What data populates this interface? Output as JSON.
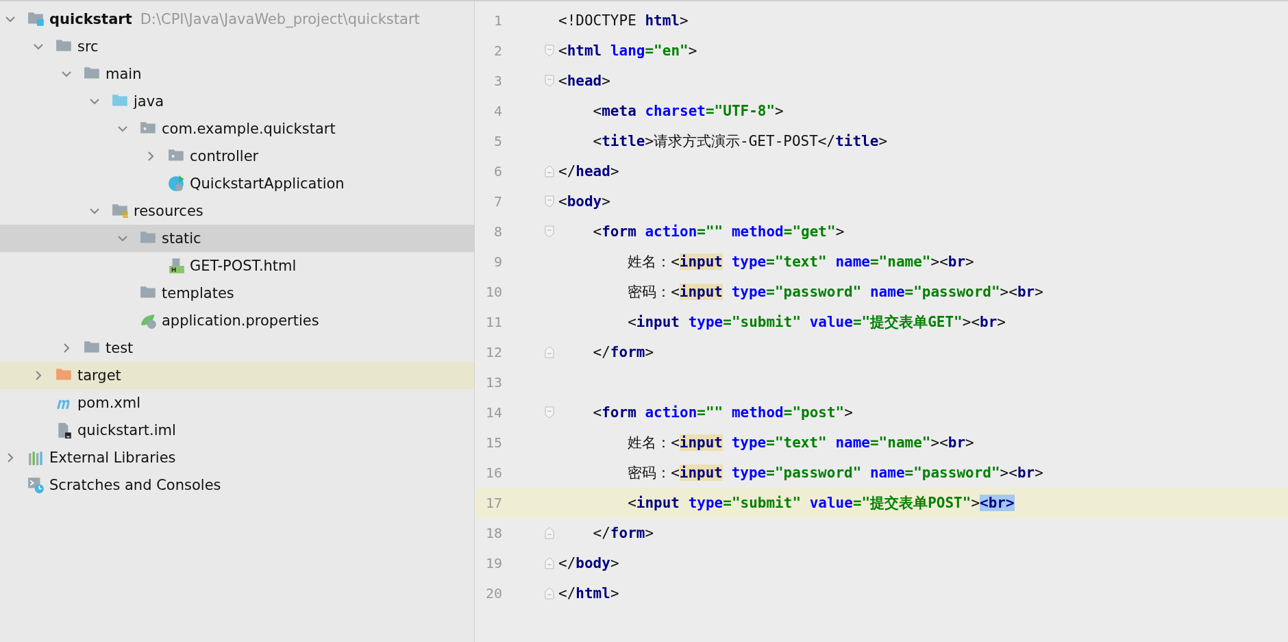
{
  "project_tree": [
    {
      "label": "quickstart",
      "hint": "D:\\CPI\\Java\\JavaWeb_project\\quickstart",
      "kind": "module",
      "expanded": true,
      "selected": false,
      "highlighted": false,
      "children": [
        {
          "label": "src",
          "kind": "folder",
          "expanded": true,
          "selected": false,
          "highlighted": false,
          "children": [
            {
              "label": "main",
              "kind": "folder",
              "expanded": true,
              "selected": false,
              "highlighted": false,
              "children": [
                {
                  "label": "java",
                  "kind": "source-folder",
                  "expanded": true,
                  "selected": false,
                  "highlighted": false,
                  "children": [
                    {
                      "label": "com.example.quickstart",
                      "kind": "package",
                      "expanded": true,
                      "selected": false,
                      "highlighted": false,
                      "children": [
                        {
                          "label": "controller",
                          "kind": "package",
                          "expanded": false,
                          "selected": false,
                          "highlighted": false
                        },
                        {
                          "label": "QuickstartApplication",
                          "kind": "spring-class",
                          "selected": false,
                          "highlighted": false
                        }
                      ]
                    }
                  ]
                },
                {
                  "label": "resources",
                  "kind": "resources-folder",
                  "expanded": true,
                  "selected": false,
                  "highlighted": false,
                  "children": [
                    {
                      "label": "static",
                      "kind": "folder",
                      "expanded": true,
                      "selected": true,
                      "highlighted": false,
                      "children": [
                        {
                          "label": "GET-POST.html",
                          "kind": "html-file",
                          "selected": false,
                          "highlighted": false
                        }
                      ]
                    },
                    {
                      "label": "templates",
                      "kind": "folder",
                      "selected": false,
                      "highlighted": false
                    },
                    {
                      "label": "application.properties",
                      "kind": "properties-file",
                      "selected": false,
                      "highlighted": false
                    }
                  ]
                }
              ]
            },
            {
              "label": "test",
              "kind": "folder",
              "expanded": false,
              "selected": false,
              "highlighted": false
            }
          ]
        },
        {
          "label": "target",
          "kind": "excluded-folder",
          "expanded": false,
          "selected": false,
          "highlighted": true
        },
        {
          "label": "pom.xml",
          "kind": "maven-file",
          "selected": false,
          "highlighted": false
        },
        {
          "label": "quickstart.iml",
          "kind": "module-file",
          "selected": false,
          "highlighted": false
        }
      ]
    },
    {
      "label": "External Libraries",
      "kind": "libraries",
      "expanded": false,
      "selected": false,
      "highlighted": false
    },
    {
      "label": "Scratches and Consoles",
      "kind": "scratches",
      "selected": false,
      "highlighted": false
    }
  ],
  "editor": {
    "lines": [
      {
        "number": "1",
        "current": false,
        "kind": "plain",
        "tokens": [
          {
            "kind": "punct",
            "text": "<!DOCTYPE "
          },
          {
            "kind": "tag",
            "text": "html"
          },
          {
            "kind": "punct",
            "text": ">"
          }
        ]
      },
      {
        "number": "2",
        "current": false,
        "kind": "fold-start",
        "tokens": [
          {
            "kind": "punct",
            "text": "<"
          },
          {
            "kind": "tag",
            "text": "html"
          },
          {
            "kind": "attr",
            "text": " lang"
          },
          {
            "kind": "string",
            "text": "=\"en\""
          },
          {
            "kind": "punct",
            "text": ">"
          }
        ]
      },
      {
        "number": "3",
        "current": false,
        "kind": "fold-start",
        "tokens": [
          {
            "kind": "punct",
            "text": "<"
          },
          {
            "kind": "tag",
            "text": "head"
          },
          {
            "kind": "punct",
            "text": ">"
          }
        ]
      },
      {
        "number": "4",
        "current": false,
        "kind": "plain",
        "tokens": [
          {
            "kind": "punct",
            "text": "    <"
          },
          {
            "kind": "tag",
            "text": "meta"
          },
          {
            "kind": "attr",
            "text": " charset"
          },
          {
            "kind": "string",
            "text": "=\"UTF-8\""
          },
          {
            "kind": "punct",
            "text": ">"
          }
        ]
      },
      {
        "number": "5",
        "current": false,
        "kind": "plain",
        "tokens": [
          {
            "kind": "punct",
            "text": "    <"
          },
          {
            "kind": "tag",
            "text": "title"
          },
          {
            "kind": "punct",
            "text": ">请求方式演示-GET-POST</"
          },
          {
            "kind": "tag",
            "text": "title"
          },
          {
            "kind": "punct",
            "text": ">"
          }
        ]
      },
      {
        "number": "6",
        "current": false,
        "kind": "fold-end",
        "tokens": [
          {
            "kind": "punct",
            "text": "</"
          },
          {
            "kind": "tag",
            "text": "head"
          },
          {
            "kind": "punct",
            "text": ">"
          }
        ]
      },
      {
        "number": "7",
        "current": false,
        "kind": "fold-start",
        "tokens": [
          {
            "kind": "punct",
            "text": "<"
          },
          {
            "kind": "tag",
            "text": "body"
          },
          {
            "kind": "punct",
            "text": ">"
          }
        ]
      },
      {
        "number": "8",
        "current": false,
        "kind": "fold-start",
        "tokens": [
          {
            "kind": "punct",
            "text": "    <"
          },
          {
            "kind": "tag",
            "text": "form"
          },
          {
            "kind": "attr",
            "text": " action"
          },
          {
            "kind": "string",
            "text": "=\"\""
          },
          {
            "kind": "attr",
            "text": " method"
          },
          {
            "kind": "string",
            "text": "=\"get\""
          },
          {
            "kind": "punct",
            "text": ">"
          }
        ]
      },
      {
        "number": "9",
        "current": false,
        "kind": "plain",
        "tokens": [
          {
            "kind": "punct",
            "text": "        姓名：<"
          },
          {
            "kind": "usage-tag",
            "text": "input"
          },
          {
            "kind": "attr",
            "text": " type"
          },
          {
            "kind": "string",
            "text": "=\"text\""
          },
          {
            "kind": "attr",
            "text": " name"
          },
          {
            "kind": "string",
            "text": "=\"name\""
          },
          {
            "kind": "punct",
            "text": "><"
          },
          {
            "kind": "tag",
            "text": "br"
          },
          {
            "kind": "punct",
            "text": ">"
          }
        ]
      },
      {
        "number": "10",
        "current": false,
        "kind": "plain",
        "tokens": [
          {
            "kind": "punct",
            "text": "        密码：<"
          },
          {
            "kind": "usage-tag",
            "text": "input"
          },
          {
            "kind": "attr",
            "text": " type"
          },
          {
            "kind": "string",
            "text": "=\"password\""
          },
          {
            "kind": "attr",
            "text": " name"
          },
          {
            "kind": "string",
            "text": "=\"password\""
          },
          {
            "kind": "punct",
            "text": "><"
          },
          {
            "kind": "tag",
            "text": "br"
          },
          {
            "kind": "punct",
            "text": ">"
          }
        ]
      },
      {
        "number": "11",
        "current": false,
        "kind": "plain",
        "tokens": [
          {
            "kind": "punct",
            "text": "        <"
          },
          {
            "kind": "tag",
            "text": "input"
          },
          {
            "kind": "attr",
            "text": " type"
          },
          {
            "kind": "string",
            "text": "=\"submit\""
          },
          {
            "kind": "attr",
            "text": " value"
          },
          {
            "kind": "string",
            "text": "=\"提交表单GET\""
          },
          {
            "kind": "punct",
            "text": "><"
          },
          {
            "kind": "tag",
            "text": "br"
          },
          {
            "kind": "punct",
            "text": ">"
          }
        ]
      },
      {
        "number": "12",
        "current": false,
        "kind": "fold-end",
        "tokens": [
          {
            "kind": "punct",
            "text": "    </"
          },
          {
            "kind": "tag",
            "text": "form"
          },
          {
            "kind": "punct",
            "text": ">"
          }
        ]
      },
      {
        "number": "13",
        "current": false,
        "kind": "plain"
      },
      {
        "number": "14",
        "current": false,
        "kind": "fold-start",
        "tokens": [
          {
            "kind": "punct",
            "text": "    <"
          },
          {
            "kind": "tag",
            "text": "form"
          },
          {
            "kind": "attr",
            "text": " action"
          },
          {
            "kind": "string",
            "text": "=\"\""
          },
          {
            "kind": "attr",
            "text": " method"
          },
          {
            "kind": "string",
            "text": "=\"post\""
          },
          {
            "kind": "punct",
            "text": ">"
          }
        ]
      },
      {
        "number": "15",
        "current": false,
        "kind": "plain",
        "tokens": [
          {
            "kind": "punct",
            "text": "        姓名：<"
          },
          {
            "kind": "usage-tag",
            "text": "input"
          },
          {
            "kind": "attr",
            "text": " type"
          },
          {
            "kind": "string",
            "text": "=\"text\""
          },
          {
            "kind": "attr",
            "text": " name"
          },
          {
            "kind": "string",
            "text": "=\"name\""
          },
          {
            "kind": "punct",
            "text": "><"
          },
          {
            "kind": "tag",
            "text": "br"
          },
          {
            "kind": "punct",
            "text": ">"
          }
        ]
      },
      {
        "number": "16",
        "current": false,
        "kind": "plain",
        "tokens": [
          {
            "kind": "punct",
            "text": "        密码：<"
          },
          {
            "kind": "usage-tag",
            "text": "input"
          },
          {
            "kind": "attr",
            "text": " type"
          },
          {
            "kind": "string",
            "text": "=\"password\""
          },
          {
            "kind": "attr",
            "text": " name"
          },
          {
            "kind": "string",
            "text": "=\"password\""
          },
          {
            "kind": "punct",
            "text": "><"
          },
          {
            "kind": "tag",
            "text": "br"
          },
          {
            "kind": "punct",
            "text": ">"
          }
        ]
      },
      {
        "number": "17",
        "current": true,
        "kind": "plain",
        "tokens": [
          {
            "kind": "punct",
            "text": "        <"
          },
          {
            "kind": "tag",
            "text": "input"
          },
          {
            "kind": "attr",
            "text": " type"
          },
          {
            "kind": "string",
            "text": "=\"submit\""
          },
          {
            "kind": "attr",
            "text": " value"
          },
          {
            "kind": "string",
            "text": "=\"提交表单POST\""
          },
          {
            "kind": "punct",
            "text": ">"
          },
          {
            "kind": "selection",
            "text": "<br>"
          }
        ]
      },
      {
        "number": "18",
        "current": false,
        "kind": "fold-end",
        "tokens": [
          {
            "kind": "punct",
            "text": "    </"
          },
          {
            "kind": "tag",
            "text": "form"
          },
          {
            "kind": "punct",
            "text": ">"
          }
        ]
      },
      {
        "number": "19",
        "current": false,
        "kind": "fold-end",
        "tokens": [
          {
            "kind": "punct",
            "text": "</"
          },
          {
            "kind": "tag",
            "text": "body"
          },
          {
            "kind": "punct",
            "text": ">"
          }
        ]
      },
      {
        "number": "20",
        "current": false,
        "kind": "fold-end",
        "tokens": [
          {
            "kind": "punct",
            "text": "</"
          },
          {
            "kind": "tag",
            "text": "html"
          },
          {
            "kind": "punct",
            "text": ">"
          }
        ]
      }
    ]
  }
}
